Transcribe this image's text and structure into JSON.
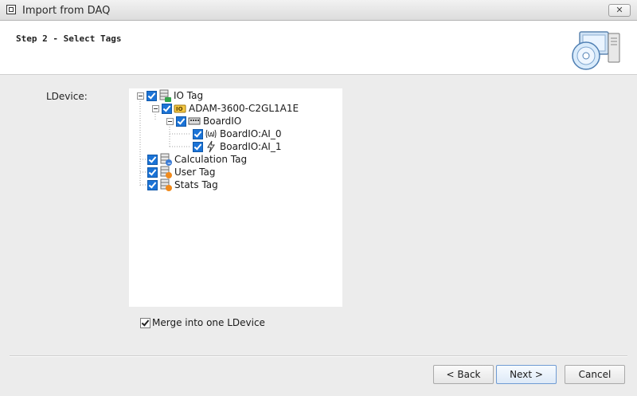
{
  "window": {
    "title": "Import from DAQ",
    "close_glyph": "✕"
  },
  "header": {
    "step_title": "Step 2 - Select Tags"
  },
  "form": {
    "ldevice_label": "LDevice:"
  },
  "tree": {
    "io_tag": "IO Tag",
    "device": "ADAM-3600-C2GL1A1E",
    "board": "BoardIO",
    "ai_0": "BoardIO:AI_0",
    "ai_1": "BoardIO:AI_1",
    "calculation": "Calculation Tag",
    "user": "User Tag",
    "stats": "Stats Tag",
    "all_checked": true
  },
  "merge": {
    "label": "Merge into one LDevice",
    "checked": true
  },
  "buttons": {
    "back": "< Back",
    "next": "Next >",
    "cancel": "Cancel"
  },
  "colors": {
    "checkbox": "#1b73d6",
    "accent_border": "#6f9bd3",
    "window_bg": "#ececec"
  }
}
